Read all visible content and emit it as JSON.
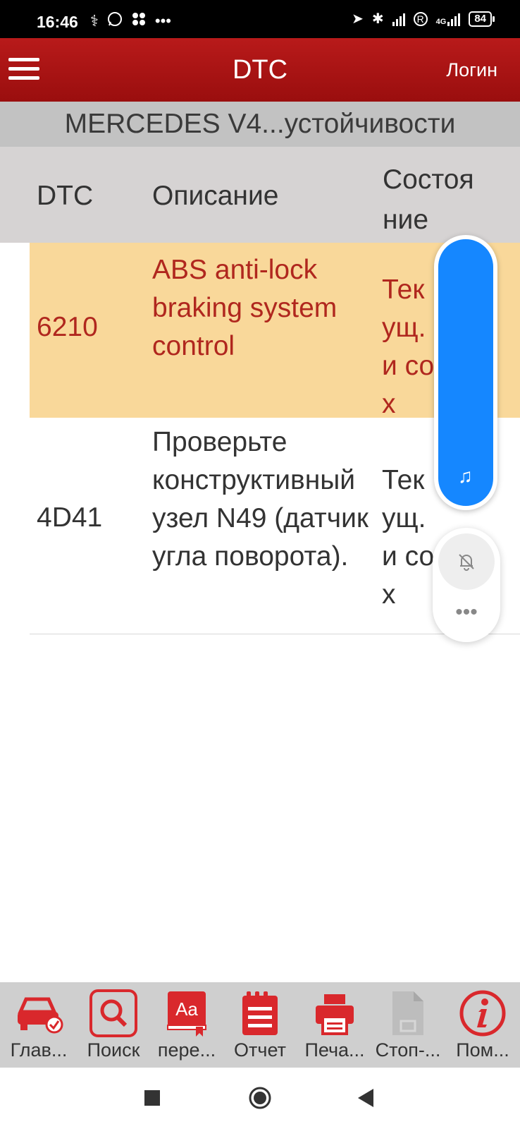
{
  "status_bar": {
    "time": "16:46",
    "left_icons": [
      "stethoscope-icon",
      "whatsapp-icon",
      "app-icon",
      "more-dots-icon"
    ],
    "battery": "84",
    "network_labels": [
      "R",
      "4G"
    ]
  },
  "app_bar": {
    "title": "DTC",
    "login_label": "Логин"
  },
  "subtitle": "MERCEDES V4...устойчивости",
  "table": {
    "headers": {
      "dtc": "DTC",
      "description": "Описание",
      "state": "Состояние"
    },
    "rows": [
      {
        "code": "6210",
        "description": "ABS anti-lock braking system control",
        "state": "Текущ. и сох",
        "highlighted": true
      },
      {
        "code": "4D41",
        "description": "Проверьте конструктивный узел N49 (датчик угла поворота).",
        "state": "Текущ. и сох",
        "highlighted": false
      }
    ]
  },
  "floating": {
    "music_icon": "music-note-icon",
    "bell_icon": "bell-off-icon",
    "more_icon": "more-icon"
  },
  "toolbar": {
    "items": [
      {
        "label": "Глав...",
        "icon": "car-check-icon",
        "enabled": true
      },
      {
        "label": "Поиск",
        "icon": "search-icon",
        "enabled": true
      },
      {
        "label": "пере...",
        "icon": "translate-icon",
        "enabled": true
      },
      {
        "label": "Отчет",
        "icon": "report-icon",
        "enabled": true
      },
      {
        "label": "Печа...",
        "icon": "printer-icon",
        "enabled": true
      },
      {
        "label": "Стоп-...",
        "icon": "document-icon",
        "enabled": false
      },
      {
        "label": "Пом...",
        "icon": "info-icon",
        "enabled": true
      }
    ]
  },
  "colors": {
    "app_bar": "#a81414",
    "highlight_row": "#f9d89a",
    "highlight_text": "#b0271e",
    "header_bg": "#d6d3d3",
    "toolbar_icon": "#d9282c",
    "float_blue": "#1587ff"
  }
}
